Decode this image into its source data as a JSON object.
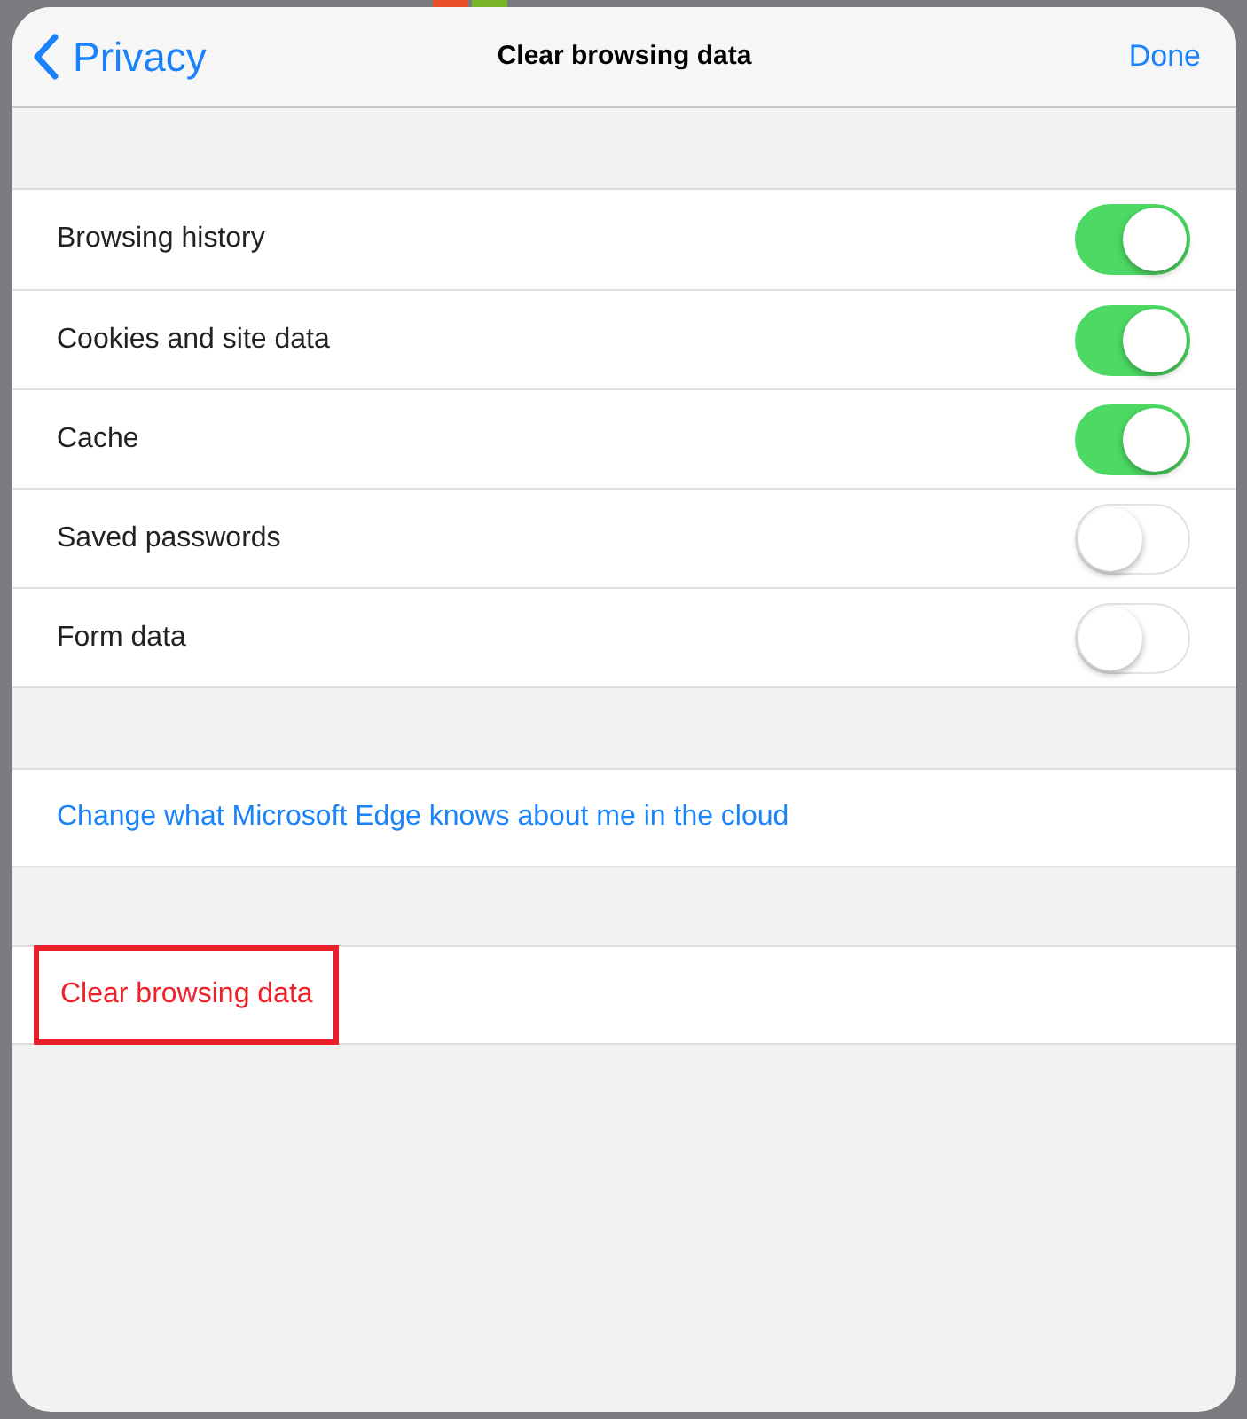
{
  "header": {
    "back": "Privacy",
    "title": "Clear browsing data",
    "done": "Done"
  },
  "toggles": [
    {
      "label": "Browsing history",
      "on": true
    },
    {
      "label": "Cookies and site data",
      "on": true
    },
    {
      "label": "Cache",
      "on": true
    },
    {
      "label": "Saved passwords",
      "on": false
    },
    {
      "label": "Form data",
      "on": false
    }
  ],
  "cloud_link": "Change what Microsoft Edge knows about me in the cloud",
  "clear_action": {
    "label": "Clear browsing data",
    "highlighted": true
  }
}
